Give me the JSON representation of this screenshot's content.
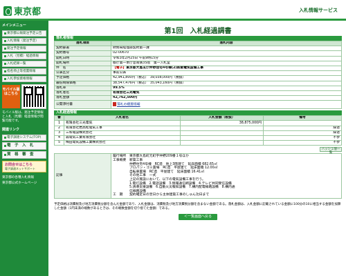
{
  "header": {
    "logo": "東京都",
    "service": "入札情報サービス"
  },
  "sidebar": {
    "menu_title": "メインメニュー",
    "items": [
      "東京都公報発注予定公告",
      "入札情報（発注予定）",
      "発注予定情報",
      "入札（見積）経過情報",
      "入札結果一覧",
      "指名停止等措置情報",
      "入札参加資格情報"
    ],
    "mobile_label": "モバイル版はこちら",
    "mobile_note": "モバイル版は、発注予定情報と入札（見積）経過情報が閲覧可能です。",
    "links_title": "関連リンク",
    "links": [
      "電子調達システム(TOP)",
      "電　子　入　札",
      "資　格　審　査"
    ],
    "opinion_title": "お問合せはこちら",
    "opinion_sub": "電子調達ネットサポート",
    "bottom_links": [
      "東京都の各種入札情報",
      "東京都公式ホームページ"
    ]
  },
  "page": {
    "title": "第1回　入札経過調書",
    "section1": "落札者情報",
    "col_item": "落札項目",
    "col_content": "落札内容",
    "rows": [
      {
        "label": "契約部署",
        "value": "財務局経理部契約第一課"
      },
      {
        "label": "契約番号",
        "value": "02-00670"
      },
      {
        "label": "開札日時",
        "value": "令和3年2月25日 午前9時15分"
      },
      {
        "label": "開札場所",
        "value": "都庁第一本庁舎南側35階　第一入札室"
      },
      {
        "label": "件　名",
        "tag": "【電子】",
        "value": "東京都大島支庁仲野住宅4号棟(2)新築電気設備工事"
      },
      {
        "label": "公表区分",
        "value": "事前公表"
      },
      {
        "label": "予定価格",
        "value": "42,941,800円（税込）　39,038,000円（税抜）"
      },
      {
        "label": "最低制限価格",
        "value": "38,547,476円（税込）　35,043,160円（税抜）"
      },
      {
        "label": "落札率",
        "value": "99.5%"
      },
      {
        "label": "落札者名",
        "value": "有限会社三光電気"
      },
      {
        "label": "落札金額",
        "value": "42,762,500円"
      },
      {
        "label": "公開添付書",
        "value": "落札の積算情報"
      }
    ],
    "section2": "入札経過情報",
    "bid_cols": [
      "番",
      "入札者名",
      "入札金額（税抜）",
      "備考"
    ],
    "bids": [
      {
        "no": "1",
        "name": "有限会社三光電気",
        "amount": "38,875,000円",
        "note": ""
      },
      {
        "no": "2",
        "name": "有限会社岩高松電気工事",
        "amount": "",
        "note": "辞退"
      },
      {
        "no": "3",
        "name": "三和電設株式会社",
        "amount": "",
        "note": "辞退"
      },
      {
        "no": "4",
        "name": "森電気工業有限会社",
        "amount": "",
        "note": "不参"
      },
      {
        "no": "5",
        "name": "梅田電気設備工業株式会社",
        "amount": "",
        "note": "不参"
      }
    ],
    "hash_button": "ハッシュ値一覧",
    "remarks_label": "記事",
    "remarks_lines": [
      "履行場所　東京都大島町元町字仲野209番１号ほか",
      "工事概要　新築工事",
      "　　　　　仲野住宅4号棟　RC造　地上3階建て　延床面積 682.65㎡",
      "　　　　　プロパン・ゴミ置場　RC造　平屋建て　延床面積 12.00㎡",
      "　　　　　自転車置場　RC造　平屋建て　延床面積 16.41㎡",
      "　　　　　その他工事　一式",
      "　　　　　上記の施設において、以下の電気設備工事を行う。",
      "　　　　　1.電灯設備　2.電話設備　3.情報通信網設備　4.テレビ共同受信設備",
      "　　　　　5.誘導支援設備　6.自動火災報知設備　7.構内配電線路設備　8.構内通",
      "　　　　　信線路設備",
      "工　期　　契約確定日の翌日から主体建築工事のしゅん功日まで"
    ],
    "footnote": "予定価格は消費税及び地方消費税分額を含んだ金額であり、入札金額は、消費税及び地方消費税分額を含まない金額である。落札金額は、入札金額に記載されている金額に100分の10に相当する金額を加算した金額（1円未満の端数があるときは、その端数金額を切り捨てた金額）である。",
    "back_button": "＜一覧画面へ戻る"
  }
}
